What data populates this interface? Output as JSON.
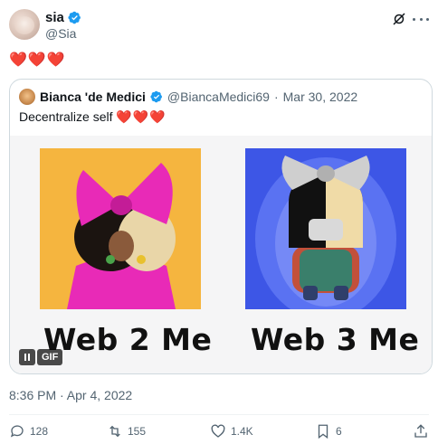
{
  "author": {
    "name": "sia",
    "handle": "@Sia"
  },
  "tweet": {
    "text": "❤️❤️❤️"
  },
  "quote": {
    "name": "Bianca 'de Medici",
    "handle": "@BiancaMedici69",
    "separator": "·",
    "date": "Mar 30, 2022",
    "text": "Decentralize self",
    "hearts": "❤️❤️❤️",
    "media": {
      "left_caption": "Web 2 Me",
      "right_caption": "Web 3 Me",
      "badge": "GIF"
    }
  },
  "timestamp": "8:36 PM · Apr 4, 2022",
  "actions": {
    "replies": "128",
    "reposts": "155",
    "likes": "1.4K",
    "bookmarks": "6"
  },
  "colors": {
    "verified": "#1d9bf0",
    "heart": "#e0245e",
    "muted": "#536471"
  }
}
